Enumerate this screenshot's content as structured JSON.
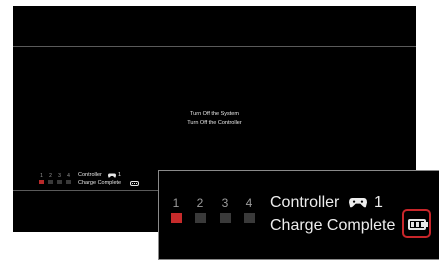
{
  "menu": {
    "items": [
      {
        "label": "Turn Off the System"
      },
      {
        "label": "Turn Off the Controller"
      }
    ]
  },
  "controller_status": {
    "ports": [
      "1",
      "2",
      "3",
      "4"
    ],
    "active_port": "1",
    "controller_label": "Controller",
    "controller_number": "1",
    "controller_icon": "gamepad-icon",
    "battery_icon": "battery-icon",
    "battery_level": "full",
    "status_text": "Charge Complete"
  },
  "colors": {
    "background": "#000000",
    "active_port": "#c62b2b",
    "inactive_port": "#3a3a3a",
    "highlight_ring": "#c8262a",
    "text": "#ededed"
  }
}
